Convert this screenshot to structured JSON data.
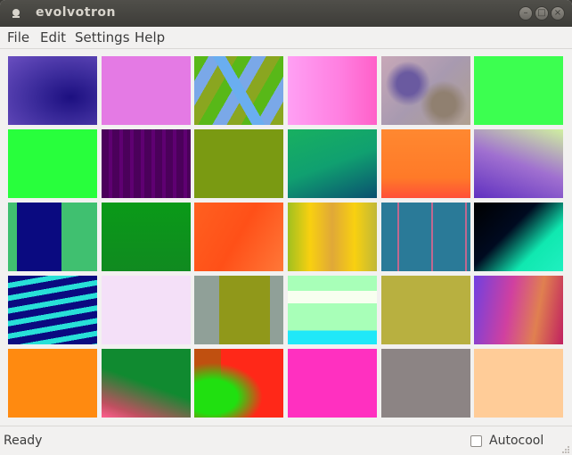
{
  "window": {
    "title": "evolvotron"
  },
  "menubar": {
    "items": [
      {
        "label": "File",
        "name": "menu-file"
      },
      {
        "label": "Edit",
        "name": "menu-edit"
      },
      {
        "label": "Settings",
        "name": "menu-settings"
      },
      {
        "label": "Help",
        "name": "menu-help"
      }
    ]
  },
  "status": {
    "text": "Ready",
    "autocool_label": "Autocool",
    "autocool_checked": false
  },
  "colors": {
    "titlebar": "#3c3b37",
    "background": "#f2f1f0"
  }
}
